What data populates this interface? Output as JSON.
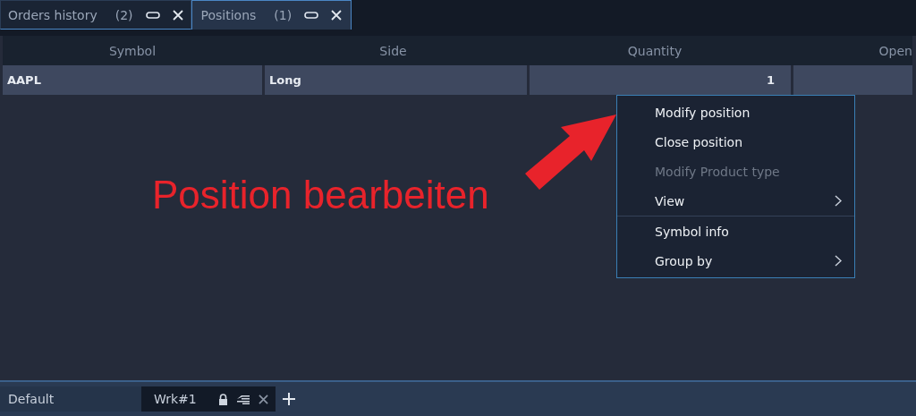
{
  "tabs": [
    {
      "label": "Orders history",
      "count": "(2)",
      "selected": false
    },
    {
      "label": "Positions",
      "count": "(1)",
      "selected": true
    }
  ],
  "table": {
    "columns": [
      "Symbol",
      "Side",
      "Quantity",
      "Open"
    ],
    "rows": [
      {
        "cells": [
          "AAPL",
          "Long",
          "1",
          ""
        ]
      }
    ]
  },
  "context_menu": {
    "groups": [
      [
        {
          "label": "Modify position",
          "disabled": false,
          "submenu": false
        },
        {
          "label": "Close position",
          "disabled": false,
          "submenu": false
        },
        {
          "label": "Modify Product type",
          "disabled": true,
          "submenu": false
        },
        {
          "label": "View",
          "disabled": false,
          "submenu": true
        }
      ],
      [
        {
          "label": "Symbol info",
          "disabled": false,
          "submenu": false
        },
        {
          "label": "Group by",
          "disabled": false,
          "submenu": true
        }
      ]
    ]
  },
  "annotation": {
    "text": "Position bearbeiten"
  },
  "bottom_bar": {
    "layout": "Default",
    "workspaces": [
      {
        "label": "Wrk#1",
        "selected": true
      }
    ]
  }
}
